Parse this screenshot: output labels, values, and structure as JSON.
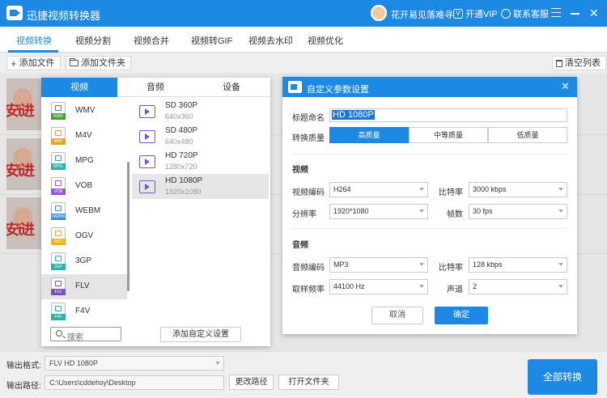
{
  "app": {
    "title": "迅捷视频转换器"
  },
  "header": {
    "user_name": "花开易见落难寻",
    "vip_label": "开通VIP",
    "vip_glyph": "V",
    "support_label": "联系客服",
    "close_glyph": "✕"
  },
  "tabs": [
    "视频转换",
    "视频分割",
    "视频合并",
    "视频转GIF",
    "视频去水印",
    "视频优化"
  ],
  "toolbar": {
    "add_file": "添加文件",
    "add_folder": "添加文件夹",
    "clear_list": "清空列表"
  },
  "file_thumbs": {
    "watermark_text": "安i进"
  },
  "format_popup": {
    "tabs": [
      "视频",
      "音频",
      "设备"
    ],
    "formats": [
      {
        "name": "WMV",
        "color": "#4a9b3e"
      },
      {
        "name": "M4V",
        "color": "#e2a72a"
      },
      {
        "name": "MPG",
        "color": "#2bb3a8"
      },
      {
        "name": "VOB",
        "color": "#9b59d0"
      },
      {
        "name": "WEBM",
        "color": "#3b8ee0"
      },
      {
        "name": "OGV",
        "color": "#f0b020"
      },
      {
        "name": "3GP",
        "color": "#2bb3a8"
      },
      {
        "name": "FLV",
        "color": "#7a54c7"
      },
      {
        "name": "F4V",
        "color": "#2bb3a8"
      }
    ],
    "selected_format": "FLV",
    "search_placeholder": "搜索",
    "presets": [
      {
        "name": "SD 360P",
        "res": "640x360"
      },
      {
        "name": "SD 480P",
        "res": "640x480"
      },
      {
        "name": "HD 720P",
        "res": "1280x720"
      },
      {
        "name": "HD 1080P",
        "res": "1920x1080"
      }
    ],
    "add_custom": "添加自定义设置"
  },
  "dialog": {
    "title": "自定义参数设置",
    "close_glyph": "✕",
    "name_label": "标题命名",
    "name_value": "HD 1080P",
    "quality_label": "转换质量",
    "quality_options": [
      "高质量",
      "中等质量",
      "低质量"
    ],
    "video_section": "视频",
    "video_codec_label": "视频编码",
    "video_codec": "H264",
    "video_bitrate_label": "比特率",
    "video_bitrate": "3000 kbps",
    "resolution_label": "分辨率",
    "resolution": "1920*1080",
    "fps_label": "帧数",
    "fps": "30 fps",
    "audio_section": "音频",
    "audio_codec_label": "音频编码",
    "audio_codec": "MP3",
    "audio_bitrate_label": "比特率",
    "audio_bitrate": "128 kbps",
    "sample_rate_label": "取样频率",
    "sample_rate": "44100 Hz",
    "channels_label": "声道",
    "channels": "2",
    "cancel": "取消",
    "ok": "确定"
  },
  "bottom": {
    "format_label": "输出格式:",
    "format_value": "FLV  HD 1080P",
    "path_label": "输出路径:",
    "path_value": "C:\\Users\\cddehsy\\Desktop",
    "change_path": "更改路径",
    "open_folder": "打开文件夹",
    "convert": "全部转换"
  }
}
